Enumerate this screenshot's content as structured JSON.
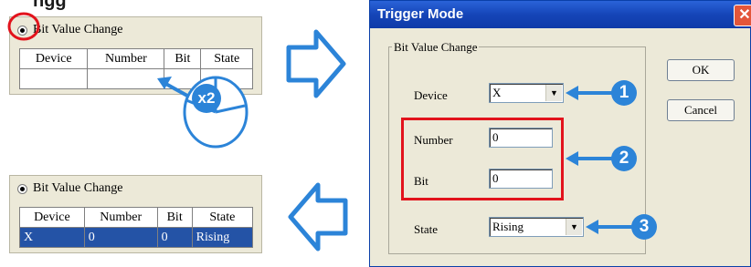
{
  "heading_fragment": "ngg",
  "colors": {
    "accent": "#2c84d8",
    "highlight_red": "#e2131c",
    "selection": "#2453a6"
  },
  "top_panel": {
    "radio_label": "Bit Value Change",
    "columns": [
      "Device",
      "Number",
      "Bit",
      "State"
    ],
    "badge": "x2"
  },
  "bottom_panel": {
    "radio_label": "Bit Value Change",
    "columns": [
      "Device",
      "Number",
      "Bit",
      "State"
    ],
    "row": [
      "X",
      "0",
      "0",
      "Rising"
    ]
  },
  "dialog": {
    "title": "Trigger Mode",
    "close_glyph": "✕",
    "group_label": "Bit Value Change",
    "ok": "OK",
    "cancel": "Cancel",
    "device_label": "Device",
    "device_value": "X",
    "number_label": "Number",
    "number_value": "0",
    "bit_label": "Bit",
    "bit_value": "0",
    "state_label": "State",
    "state_value": "Rising",
    "dropdown_glyph": "▼"
  },
  "callouts": [
    "1",
    "2",
    "3"
  ],
  "icons": [
    "arrow-right-icon",
    "arrow-left-icon",
    "mouse-icon",
    "radio-icon"
  ]
}
